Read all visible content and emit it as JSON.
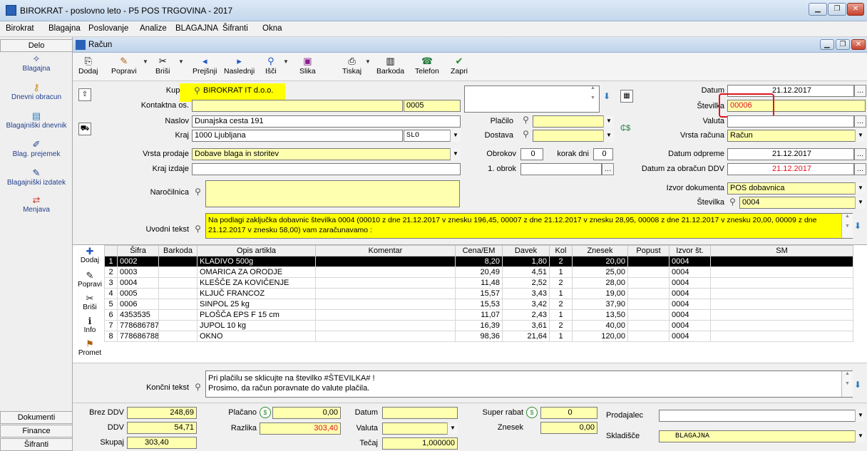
{
  "app": {
    "title": "BIROKRAT - poslovno leto - P5 POS TRGOVINA - 2017"
  },
  "menu": [
    "Birokrat",
    "Blagajna",
    "Poslovanje",
    "Analize",
    "BLAGAJNA",
    "Šifranti",
    "Okna"
  ],
  "sidebar": {
    "header": "Delo",
    "items": [
      {
        "label": "Blagajna",
        "icon": "cash-register-icon"
      },
      {
        "label": "Dnevni obracun",
        "icon": "key-icon"
      },
      {
        "label": "Blagajniški dnevnik",
        "icon": "journal-icon"
      },
      {
        "label": "Blag. prejemek",
        "icon": "receipt-in-icon"
      },
      {
        "label": "Blagajniški izdatek",
        "icon": "receipt-out-icon"
      },
      {
        "label": "Menjava",
        "icon": "exchange-icon"
      }
    ],
    "footer": [
      "Dokumenti",
      "Finance",
      "Šifranti"
    ]
  },
  "document": {
    "title": "Račun"
  },
  "toolbar": [
    {
      "label": "Dodaj",
      "icon": "add-doc-icon"
    },
    {
      "label": "Popravi",
      "icon": "edit-icon"
    },
    {
      "label": "Briši",
      "icon": "delete-icon"
    },
    {
      "label": "Prejšnji",
      "icon": "arrow-left-icon"
    },
    {
      "label": "Naslednji",
      "icon": "arrow-right-icon"
    },
    {
      "label": "Išči",
      "icon": "search-icon"
    },
    {
      "label": "Slika",
      "icon": "image-icon"
    },
    {
      "label": "Tiskaj",
      "icon": "printer-icon"
    },
    {
      "label": "Barkoda",
      "icon": "barcode-icon"
    },
    {
      "label": "Telefon",
      "icon": "phone-icon"
    },
    {
      "label": "Zapri",
      "icon": "checkmark-icon"
    }
  ],
  "form": {
    "kupec_label": "Kupec",
    "kupec": "BIROKRAT IT d.o.o.",
    "kontakt_label": "Kontaktna os.",
    "kontakt": "",
    "kontakt_code": "0005",
    "naslov_label": "Naslov",
    "naslov": "Dunajska cesta 191",
    "kraj_label": "Kraj",
    "kraj": "1000 Ljubljana",
    "drzava": "SLO",
    "placilo_label": "Plačilo",
    "placilo": "",
    "dostava_label": "Dostava",
    "dostava": "",
    "datum_label": "Datum",
    "datum": "21.12.2017",
    "stevilka_label": "Številka",
    "stevilka": "00006",
    "valuta_label": "Valuta",
    "valuta": "",
    "vrsta_racuna_label": "Vrsta računa",
    "vrsta_racuna": "Račun",
    "vrsta_prodaje_label": "Vrsta prodaje",
    "vrsta_prodaje": "Dobave blaga in storitev",
    "kraj_izdaje_label": "Kraj izdaje",
    "kraj_izdaje": "",
    "obrokov_label": "Obrokov",
    "obrokov": "0",
    "korak_dni_label": "korak dni",
    "korak_dni": "0",
    "obrok1_label": "1. obrok",
    "obrok1": "",
    "datum_odpreme_label": "Datum odpreme",
    "datum_odpreme": "21.12.2017",
    "datum_ddv_label": "Datum za obračun DDV",
    "datum_ddv": "21.12.2017",
    "narocilnica_label": "Naročilnica",
    "narocilnica": "",
    "izvor_label": "Izvor dokumenta",
    "izvor": "POS dobavnica",
    "izvor_st_label": "Številka",
    "izvor_st": "0004",
    "uvodni_label": "Uvodni tekst",
    "uvodni": "Na podlagi zaključka dobavnic številka 0004 (00010 z dne 21.12.2017 v znesku 196,45, 00007 z dne 21.12.2017 v znesku 28,95, 00008 z dne 21.12.2017 v znesku 20,00, 00009 z dne 21.12.2017 v znesku 58,00) vam zaračunavamo :",
    "koncni_label": "Končni tekst",
    "koncni_line1": "Pri plačilu se sklicujte na številko #ŠTEVILKA# !",
    "koncni_line2": "Prosimo, da račun poravnate do valute plačila."
  },
  "grid": {
    "side": [
      {
        "label": "Dodaj",
        "icon": "plus-icon"
      },
      {
        "label": "Popravi",
        "icon": "edit-icon"
      },
      {
        "label": "Briši",
        "icon": "scissors-icon"
      },
      {
        "label": "Info",
        "icon": "info-icon"
      },
      {
        "label": "Promet",
        "icon": "traffic-icon"
      }
    ],
    "columns": [
      "",
      "Šifra",
      "Barkoda",
      "Opis artikla",
      "Komentar",
      "Cena/EM",
      "Davek",
      "Kol",
      "Znesek",
      "Popust",
      "Izvor št.",
      "SM"
    ],
    "rows": [
      [
        "1",
        "0002",
        "",
        "KLADIVO 500g",
        "",
        "8,20",
        "1,80",
        "2",
        "20,00",
        "",
        "0004",
        ""
      ],
      [
        "2",
        "0003",
        "",
        "OMARICA ZA ORODJE",
        "",
        "20,49",
        "4,51",
        "1",
        "25,00",
        "",
        "0004",
        ""
      ],
      [
        "3",
        "0004",
        "",
        "KLEŠČE ZA KOVIČENJE",
        "",
        "11,48",
        "2,52",
        "2",
        "28,00",
        "",
        "0004",
        ""
      ],
      [
        "4",
        "0005",
        "",
        "KLJUČ FRANCOZ",
        "",
        "15,57",
        "3,43",
        "1",
        "19,00",
        "",
        "0004",
        ""
      ],
      [
        "5",
        "0006",
        "",
        "SINPOL 25 kg",
        "",
        "15,53",
        "3,42",
        "2",
        "37,90",
        "",
        "0004",
        ""
      ],
      [
        "6",
        "4353535",
        "",
        "PLOŠČA EPS F 15 cm",
        "",
        "11,07",
        "2,43",
        "1",
        "13,50",
        "",
        "0004",
        ""
      ],
      [
        "7",
        "778686787",
        "",
        "JUPOL 10 kg",
        "",
        "16,39",
        "3,61",
        "2",
        "40,00",
        "",
        "0004",
        ""
      ],
      [
        "8",
        "778686788",
        "",
        "OKNO",
        "",
        "98,36",
        "21,64",
        "1",
        "120,00",
        "",
        "0004",
        ""
      ]
    ]
  },
  "totals": {
    "brez_ddv_label": "Brez DDV",
    "brez_ddv": "248,69",
    "ddv_label": "DDV",
    "ddv": "54,71",
    "skupaj_label": "Skupaj",
    "skupaj": "303,40",
    "placano_label": "Plačano",
    "placano": "0,00",
    "razlika_label": "Razlika",
    "razlika": "303,40",
    "datum_label": "Datum",
    "datum": "",
    "valuta_label": "Valuta",
    "valuta": "",
    "tecaj_label": "Tečaj",
    "tecaj": "1,000000",
    "super_rabat_label": "Super rabat",
    "super_rabat": "0",
    "znesek_label": "Znesek",
    "znesek": "0,00",
    "prodajalec_label": "Prodajalec",
    "prodajalec": "",
    "skladisce_label": "Skladišče",
    "skladisce": "BLAGAJNA"
  },
  "colors": {
    "highlight": "#ffff00",
    "field_yellow": "#ffffb0",
    "accent_red": "#e0141e",
    "link_blue": "#23408f"
  }
}
